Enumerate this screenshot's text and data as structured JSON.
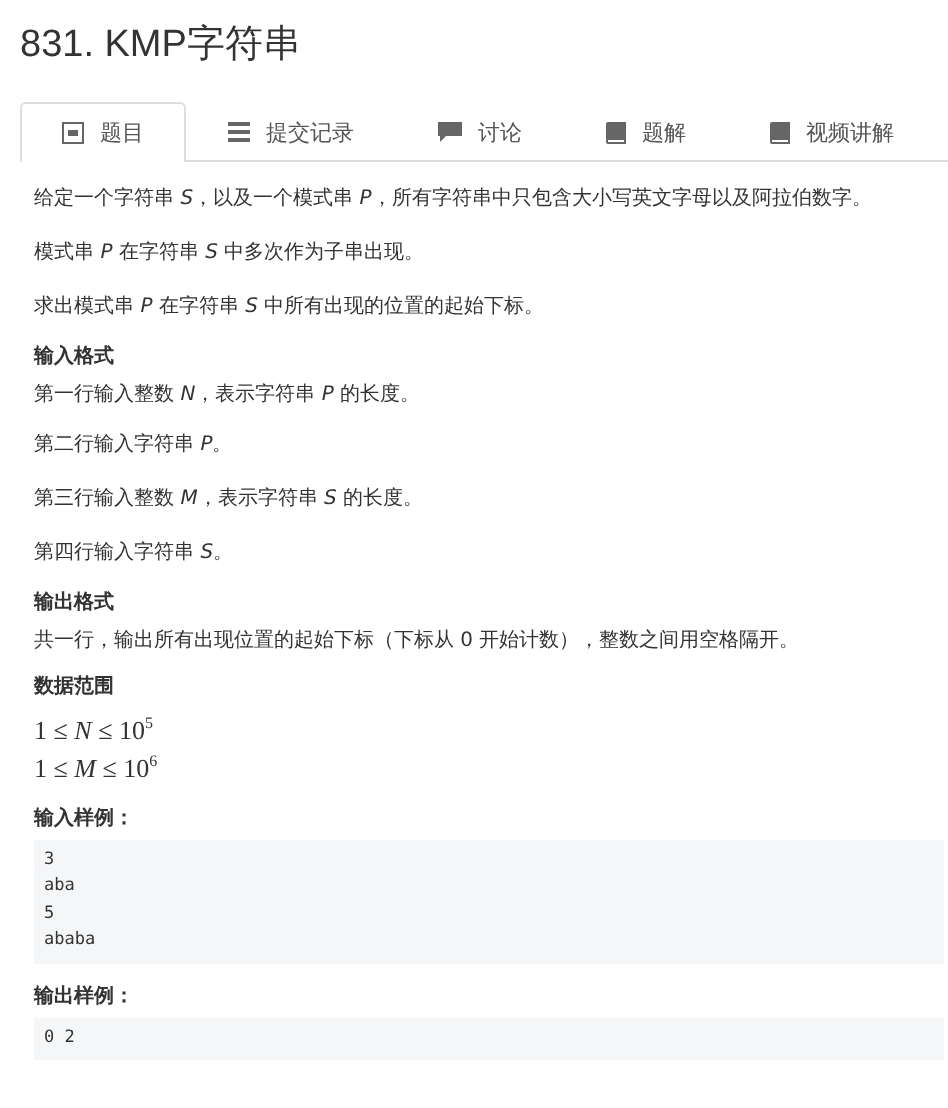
{
  "title": "831. KMP字符串",
  "tabs": [
    {
      "label": "题目",
      "kind": "doc",
      "selected": true
    },
    {
      "label": "提交记录",
      "kind": "list",
      "selected": false
    },
    {
      "label": "讨论",
      "kind": "chat",
      "selected": false
    },
    {
      "label": "题解",
      "kind": "book",
      "selected": false
    },
    {
      "label": "视频讲解",
      "kind": "book",
      "selected": false
    }
  ],
  "sections": [
    {
      "kind": "paragraph",
      "text": "给定一个字符串 *S*，以及一个模式串 *P*，所有字符串中只包含大小写英文字母以及阿拉伯数字。"
    },
    {
      "kind": "paragraph",
      "text": "模式串 *P* 在字符串 *S* 中多次作为子串出现。"
    },
    {
      "kind": "paragraph",
      "text": "求出模式串 *P* 在字符串 *S* 中所有出现的位置的起始下标。"
    },
    {
      "kind": "heading",
      "text": "输入格式"
    },
    {
      "kind": "line",
      "text": "第一行输入整数 *N*，表示字符串 *P* 的长度。"
    },
    {
      "kind": "paragraph",
      "text": "第二行输入字符串 *P*。"
    },
    {
      "kind": "paragraph",
      "text": "第三行输入整数 *M*，表示字符串 *S* 的长度。"
    },
    {
      "kind": "paragraph",
      "text": "第四行输入字符串 *S*。"
    },
    {
      "kind": "heading",
      "text": "输出格式"
    },
    {
      "kind": "line",
      "text": "共一行，输出所有出现位置的起始下标（下标从 0 开始计数），整数之间用空格隔开。"
    },
    {
      "kind": "heading",
      "text": "数据范围"
    },
    {
      "kind": "math",
      "lines": [
        "1 ≤ *N* ≤ 10$^{5}$",
        "1 ≤ *M* ≤ 10$^{6}$"
      ]
    },
    {
      "kind": "heading",
      "text": "输入样例："
    },
    {
      "kind": "code",
      "lines": [
        "3",
        "aba",
        "5",
        "ababa"
      ]
    },
    {
      "kind": "heading",
      "text": "输出样例："
    },
    {
      "kind": "code",
      "lines": [
        "0 2"
      ]
    }
  ]
}
